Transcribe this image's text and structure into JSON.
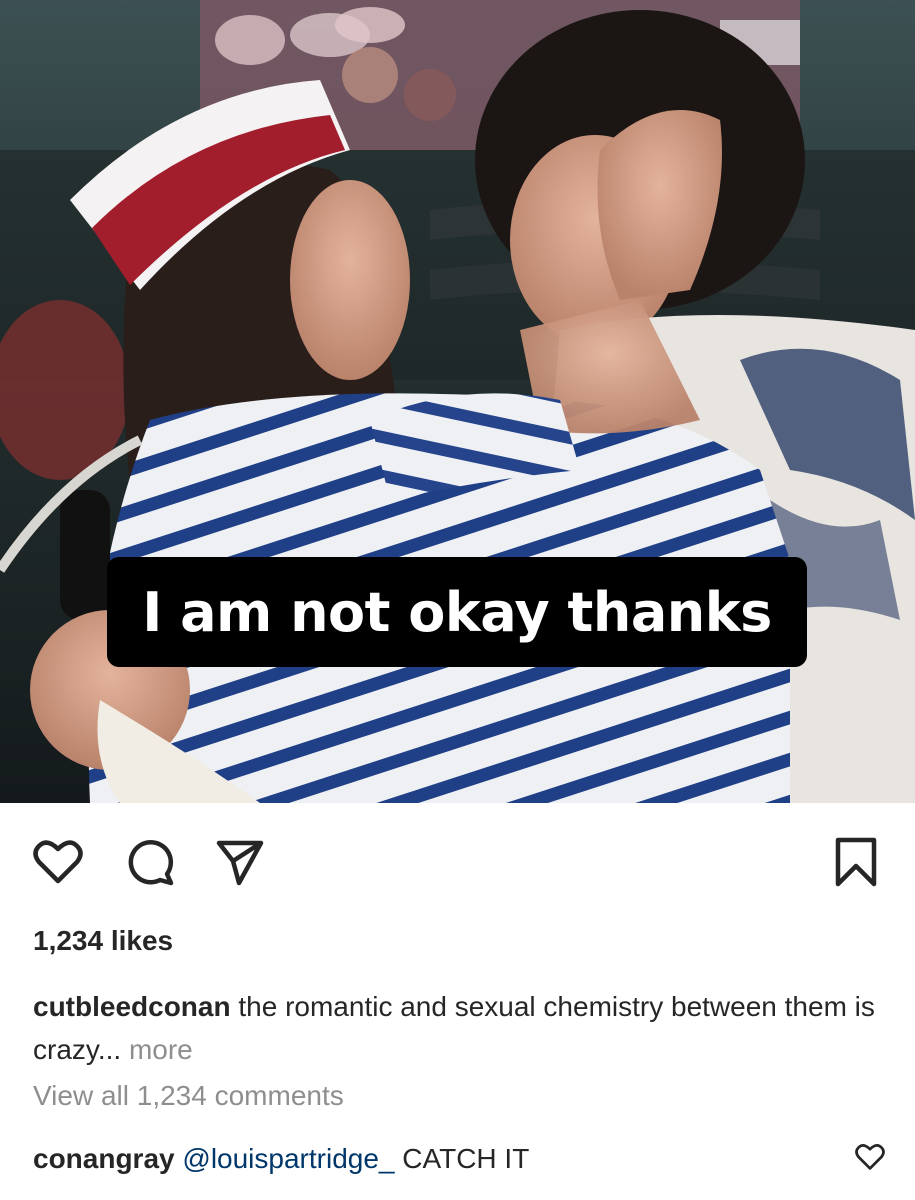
{
  "post": {
    "overlay_text": "I am not okay thanks",
    "likes_text": "1,234 likes",
    "caption": {
      "username": "cutbleedconan",
      "text": "the romantic and sexual chemistry between them is crazy...",
      "more_label": "more"
    },
    "view_comments_label": "View all 1,234 comments"
  },
  "actions": {
    "like_icon": "heart-icon",
    "comment_icon": "comment-bubble-icon",
    "share_icon": "paper-plane-icon",
    "save_icon": "bookmark-icon"
  },
  "comments": [
    {
      "username": "conangray",
      "mention": "@louispartridge_",
      "text": "CATCH IT"
    }
  ],
  "colors": {
    "text": "#262626",
    "muted": "#8e8e8e",
    "mention": "#00376b",
    "sticker_bg": "#000000",
    "sticker_text": "#ffffff"
  }
}
